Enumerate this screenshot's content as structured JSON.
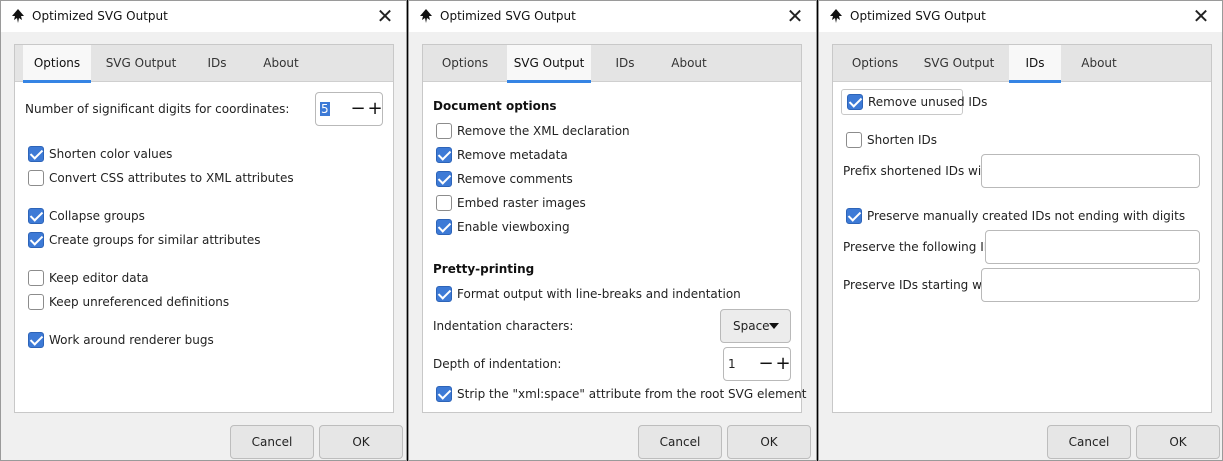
{
  "window_title": "Optimized SVG Output",
  "close_glyph": "✕",
  "tabs": {
    "options": "Options",
    "svg_output": "SVG Output",
    "ids": "IDs",
    "about": "About"
  },
  "buttons": {
    "cancel": "Cancel",
    "ok": "OK"
  },
  "options_tab": {
    "digits_label": "Number of significant digits for coordinates:",
    "digits_value": "5",
    "shorten_color": "Shorten color values",
    "convert_css": "Convert CSS attributes to XML attributes",
    "collapse_groups": "Collapse groups",
    "create_groups": "Create groups for similar attributes",
    "keep_editor": "Keep editor data",
    "keep_unref": "Keep unreferenced definitions",
    "renderer_bugs": "Work around renderer bugs"
  },
  "svg_output_tab": {
    "document_options": "Document options",
    "remove_xml": "Remove the XML declaration",
    "remove_metadata": "Remove metadata",
    "remove_comments": "Remove comments",
    "embed_raster": "Embed raster images",
    "enable_viewboxing": "Enable viewboxing",
    "pretty_printing": "Pretty-printing",
    "format_output": "Format output with line-breaks and indentation",
    "indent_chars_label": "Indentation characters:",
    "indent_chars_value": "Space",
    "depth_label": "Depth of indentation:",
    "depth_value": "1",
    "strip_xml_space": "Strip the \"xml:space\" attribute from the root SVG element"
  },
  "ids_tab": {
    "remove_unused": "Remove unused IDs",
    "shorten_ids": "Shorten IDs",
    "prefix_label": "Prefix shortened IDs with:",
    "preserve_manual": "Preserve manually created IDs not ending with digits",
    "preserve_following": "Preserve the following IDs:",
    "preserve_starting": "Preserve IDs starting with:"
  },
  "colors": {
    "accent": "#3584e4",
    "checkbox_on": "#3d7ad6"
  },
  "icons": {
    "app": "inkscape-icon",
    "close": "close-icon",
    "dropdown": "dropdown-arrow-icon"
  }
}
